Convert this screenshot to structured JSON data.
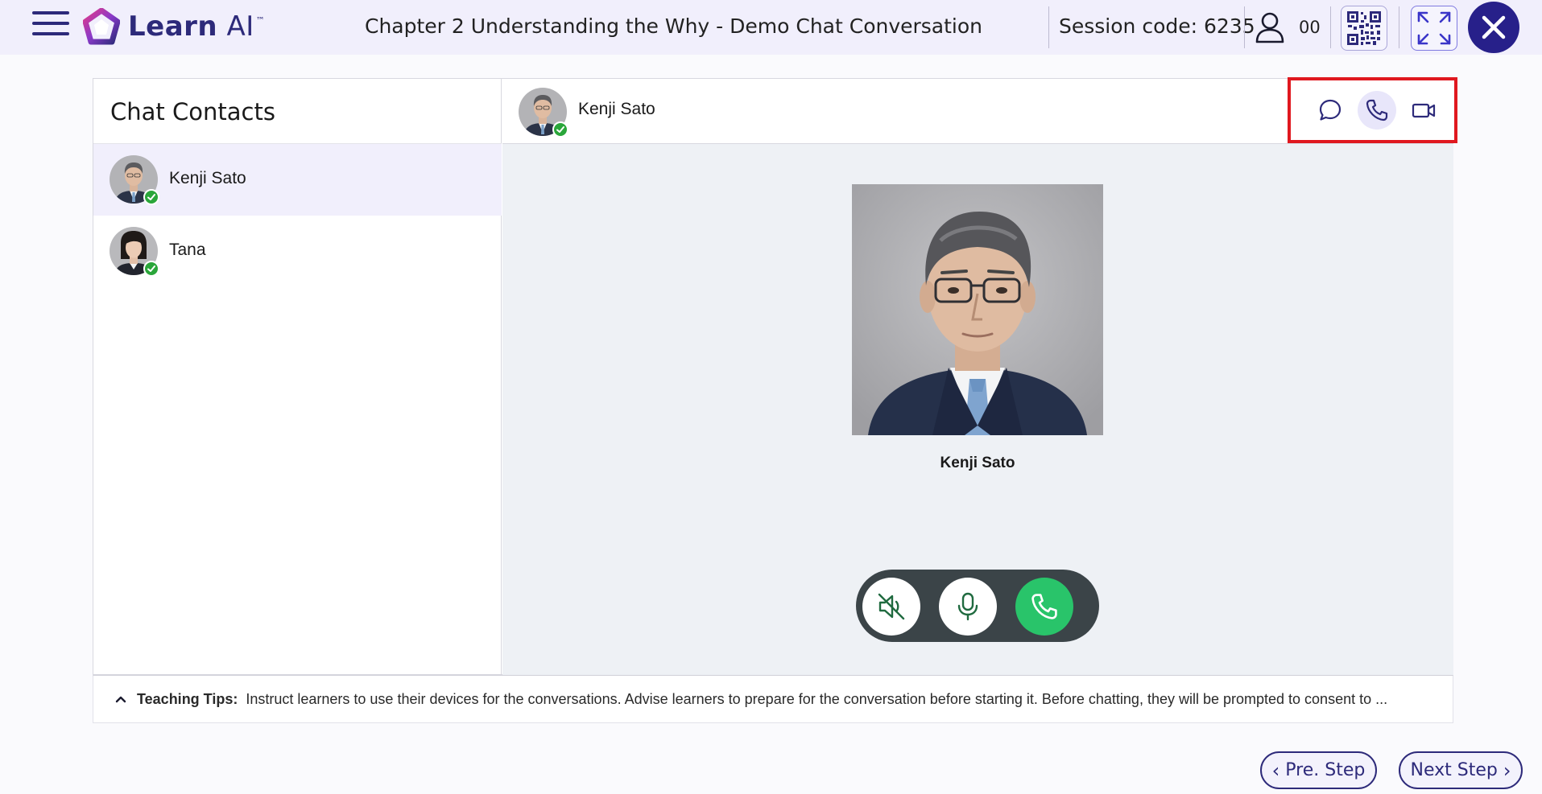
{
  "app": {
    "logo_text_bold": "Learn",
    "logo_text_light": " AI",
    "logo_tm": "™",
    "title": "Chapter 2 Understanding the Why - Demo Chat Conversation",
    "session_label": "Session code: 6235",
    "user_count": "00"
  },
  "contacts": {
    "title": "Chat Contacts",
    "items": [
      {
        "name": "Kenji Sato",
        "status": "online",
        "active": true
      },
      {
        "name": "Tana",
        "status": "online",
        "active": false
      }
    ]
  },
  "chat": {
    "contact_name": "Kenji Sato",
    "header_icons": [
      "chat-bubble-icon",
      "phone-icon",
      "video-camera-icon"
    ],
    "active_mode": "phone"
  },
  "call": {
    "callee_name": "Kenji Sato",
    "controls": [
      "speaker-off-icon",
      "microphone-icon",
      "phone-icon"
    ]
  },
  "tips": {
    "label": "Teaching Tips:",
    "text": "Instruct learners to use their devices for the conversations. Advise learners to prepare for the conversation before starting it. Before chatting, they will be prompted to consent to ..."
  },
  "nav": {
    "prev": "Pre. Step",
    "next": "Next Step"
  },
  "colors": {
    "brand": "#2d2a7a",
    "topbar_bg": "#f1effc",
    "online": "#2aa63a",
    "call_green": "#29c46a",
    "highlight": "#e0181f"
  }
}
